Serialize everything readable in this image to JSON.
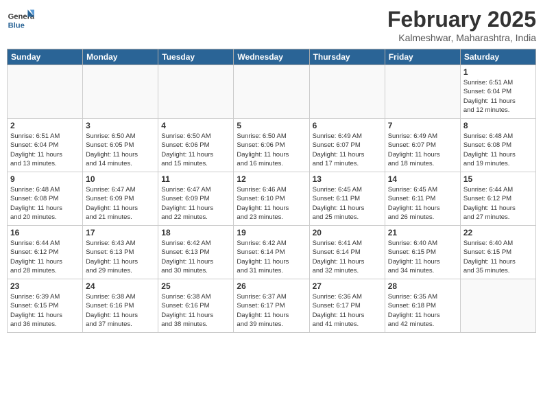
{
  "header": {
    "logo_general": "General",
    "logo_blue": "Blue",
    "title": "February 2025",
    "location": "Kalmeshwar, Maharashtra, India"
  },
  "days_of_week": [
    "Sunday",
    "Monday",
    "Tuesday",
    "Wednesday",
    "Thursday",
    "Friday",
    "Saturday"
  ],
  "weeks": [
    [
      {
        "num": "",
        "info": ""
      },
      {
        "num": "",
        "info": ""
      },
      {
        "num": "",
        "info": ""
      },
      {
        "num": "",
        "info": ""
      },
      {
        "num": "",
        "info": ""
      },
      {
        "num": "",
        "info": ""
      },
      {
        "num": "1",
        "info": "Sunrise: 6:51 AM\nSunset: 6:04 PM\nDaylight: 11 hours\nand 12 minutes."
      }
    ],
    [
      {
        "num": "2",
        "info": "Sunrise: 6:51 AM\nSunset: 6:04 PM\nDaylight: 11 hours\nand 13 minutes."
      },
      {
        "num": "3",
        "info": "Sunrise: 6:50 AM\nSunset: 6:05 PM\nDaylight: 11 hours\nand 14 minutes."
      },
      {
        "num": "4",
        "info": "Sunrise: 6:50 AM\nSunset: 6:06 PM\nDaylight: 11 hours\nand 15 minutes."
      },
      {
        "num": "5",
        "info": "Sunrise: 6:50 AM\nSunset: 6:06 PM\nDaylight: 11 hours\nand 16 minutes."
      },
      {
        "num": "6",
        "info": "Sunrise: 6:49 AM\nSunset: 6:07 PM\nDaylight: 11 hours\nand 17 minutes."
      },
      {
        "num": "7",
        "info": "Sunrise: 6:49 AM\nSunset: 6:07 PM\nDaylight: 11 hours\nand 18 minutes."
      },
      {
        "num": "8",
        "info": "Sunrise: 6:48 AM\nSunset: 6:08 PM\nDaylight: 11 hours\nand 19 minutes."
      }
    ],
    [
      {
        "num": "9",
        "info": "Sunrise: 6:48 AM\nSunset: 6:08 PM\nDaylight: 11 hours\nand 20 minutes."
      },
      {
        "num": "10",
        "info": "Sunrise: 6:47 AM\nSunset: 6:09 PM\nDaylight: 11 hours\nand 21 minutes."
      },
      {
        "num": "11",
        "info": "Sunrise: 6:47 AM\nSunset: 6:09 PM\nDaylight: 11 hours\nand 22 minutes."
      },
      {
        "num": "12",
        "info": "Sunrise: 6:46 AM\nSunset: 6:10 PM\nDaylight: 11 hours\nand 23 minutes."
      },
      {
        "num": "13",
        "info": "Sunrise: 6:45 AM\nSunset: 6:11 PM\nDaylight: 11 hours\nand 25 minutes."
      },
      {
        "num": "14",
        "info": "Sunrise: 6:45 AM\nSunset: 6:11 PM\nDaylight: 11 hours\nand 26 minutes."
      },
      {
        "num": "15",
        "info": "Sunrise: 6:44 AM\nSunset: 6:12 PM\nDaylight: 11 hours\nand 27 minutes."
      }
    ],
    [
      {
        "num": "16",
        "info": "Sunrise: 6:44 AM\nSunset: 6:12 PM\nDaylight: 11 hours\nand 28 minutes."
      },
      {
        "num": "17",
        "info": "Sunrise: 6:43 AM\nSunset: 6:13 PM\nDaylight: 11 hours\nand 29 minutes."
      },
      {
        "num": "18",
        "info": "Sunrise: 6:42 AM\nSunset: 6:13 PM\nDaylight: 11 hours\nand 30 minutes."
      },
      {
        "num": "19",
        "info": "Sunrise: 6:42 AM\nSunset: 6:14 PM\nDaylight: 11 hours\nand 31 minutes."
      },
      {
        "num": "20",
        "info": "Sunrise: 6:41 AM\nSunset: 6:14 PM\nDaylight: 11 hours\nand 32 minutes."
      },
      {
        "num": "21",
        "info": "Sunrise: 6:40 AM\nSunset: 6:15 PM\nDaylight: 11 hours\nand 34 minutes."
      },
      {
        "num": "22",
        "info": "Sunrise: 6:40 AM\nSunset: 6:15 PM\nDaylight: 11 hours\nand 35 minutes."
      }
    ],
    [
      {
        "num": "23",
        "info": "Sunrise: 6:39 AM\nSunset: 6:15 PM\nDaylight: 11 hours\nand 36 minutes."
      },
      {
        "num": "24",
        "info": "Sunrise: 6:38 AM\nSunset: 6:16 PM\nDaylight: 11 hours\nand 37 minutes."
      },
      {
        "num": "25",
        "info": "Sunrise: 6:38 AM\nSunset: 6:16 PM\nDaylight: 11 hours\nand 38 minutes."
      },
      {
        "num": "26",
        "info": "Sunrise: 6:37 AM\nSunset: 6:17 PM\nDaylight: 11 hours\nand 39 minutes."
      },
      {
        "num": "27",
        "info": "Sunrise: 6:36 AM\nSunset: 6:17 PM\nDaylight: 11 hours\nand 41 minutes."
      },
      {
        "num": "28",
        "info": "Sunrise: 6:35 AM\nSunset: 6:18 PM\nDaylight: 11 hours\nand 42 minutes."
      },
      {
        "num": "",
        "info": ""
      }
    ]
  ]
}
